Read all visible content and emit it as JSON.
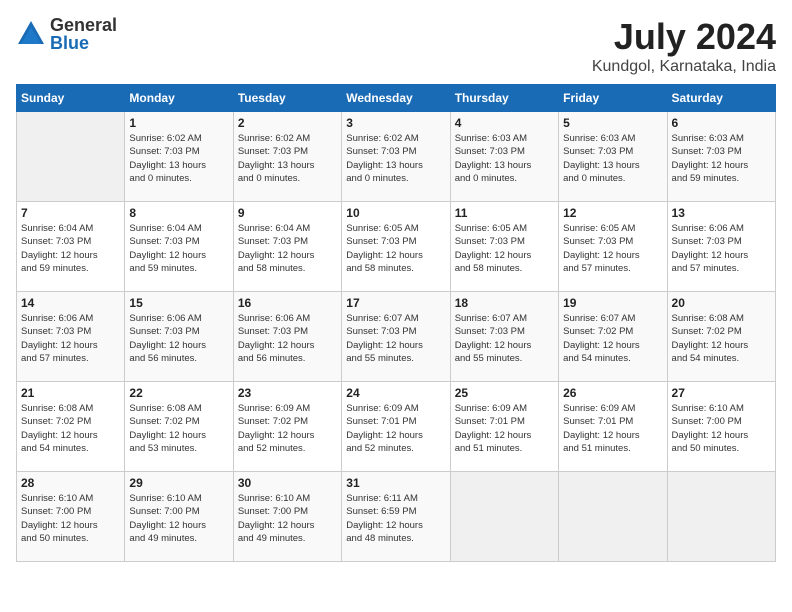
{
  "header": {
    "logo_general": "General",
    "logo_blue": "Blue",
    "title": "July 2024",
    "location": "Kundgol, Karnataka, India"
  },
  "calendar": {
    "days_of_week": [
      "Sunday",
      "Monday",
      "Tuesday",
      "Wednesday",
      "Thursday",
      "Friday",
      "Saturday"
    ],
    "weeks": [
      [
        {
          "day": "",
          "info": ""
        },
        {
          "day": "1",
          "info": "Sunrise: 6:02 AM\nSunset: 7:03 PM\nDaylight: 13 hours\nand 0 minutes."
        },
        {
          "day": "2",
          "info": "Sunrise: 6:02 AM\nSunset: 7:03 PM\nDaylight: 13 hours\nand 0 minutes."
        },
        {
          "day": "3",
          "info": "Sunrise: 6:02 AM\nSunset: 7:03 PM\nDaylight: 13 hours\nand 0 minutes."
        },
        {
          "day": "4",
          "info": "Sunrise: 6:03 AM\nSunset: 7:03 PM\nDaylight: 13 hours\nand 0 minutes."
        },
        {
          "day": "5",
          "info": "Sunrise: 6:03 AM\nSunset: 7:03 PM\nDaylight: 13 hours\nand 0 minutes."
        },
        {
          "day": "6",
          "info": "Sunrise: 6:03 AM\nSunset: 7:03 PM\nDaylight: 12 hours\nand 59 minutes."
        }
      ],
      [
        {
          "day": "7",
          "info": "Sunrise: 6:04 AM\nSunset: 7:03 PM\nDaylight: 12 hours\nand 59 minutes."
        },
        {
          "day": "8",
          "info": "Sunrise: 6:04 AM\nSunset: 7:03 PM\nDaylight: 12 hours\nand 59 minutes."
        },
        {
          "day": "9",
          "info": "Sunrise: 6:04 AM\nSunset: 7:03 PM\nDaylight: 12 hours\nand 58 minutes."
        },
        {
          "day": "10",
          "info": "Sunrise: 6:05 AM\nSunset: 7:03 PM\nDaylight: 12 hours\nand 58 minutes."
        },
        {
          "day": "11",
          "info": "Sunrise: 6:05 AM\nSunset: 7:03 PM\nDaylight: 12 hours\nand 58 minutes."
        },
        {
          "day": "12",
          "info": "Sunrise: 6:05 AM\nSunset: 7:03 PM\nDaylight: 12 hours\nand 57 minutes."
        },
        {
          "day": "13",
          "info": "Sunrise: 6:06 AM\nSunset: 7:03 PM\nDaylight: 12 hours\nand 57 minutes."
        }
      ],
      [
        {
          "day": "14",
          "info": "Sunrise: 6:06 AM\nSunset: 7:03 PM\nDaylight: 12 hours\nand 57 minutes."
        },
        {
          "day": "15",
          "info": "Sunrise: 6:06 AM\nSunset: 7:03 PM\nDaylight: 12 hours\nand 56 minutes."
        },
        {
          "day": "16",
          "info": "Sunrise: 6:06 AM\nSunset: 7:03 PM\nDaylight: 12 hours\nand 56 minutes."
        },
        {
          "day": "17",
          "info": "Sunrise: 6:07 AM\nSunset: 7:03 PM\nDaylight: 12 hours\nand 55 minutes."
        },
        {
          "day": "18",
          "info": "Sunrise: 6:07 AM\nSunset: 7:03 PM\nDaylight: 12 hours\nand 55 minutes."
        },
        {
          "day": "19",
          "info": "Sunrise: 6:07 AM\nSunset: 7:02 PM\nDaylight: 12 hours\nand 54 minutes."
        },
        {
          "day": "20",
          "info": "Sunrise: 6:08 AM\nSunset: 7:02 PM\nDaylight: 12 hours\nand 54 minutes."
        }
      ],
      [
        {
          "day": "21",
          "info": "Sunrise: 6:08 AM\nSunset: 7:02 PM\nDaylight: 12 hours\nand 54 minutes."
        },
        {
          "day": "22",
          "info": "Sunrise: 6:08 AM\nSunset: 7:02 PM\nDaylight: 12 hours\nand 53 minutes."
        },
        {
          "day": "23",
          "info": "Sunrise: 6:09 AM\nSunset: 7:02 PM\nDaylight: 12 hours\nand 52 minutes."
        },
        {
          "day": "24",
          "info": "Sunrise: 6:09 AM\nSunset: 7:01 PM\nDaylight: 12 hours\nand 52 minutes."
        },
        {
          "day": "25",
          "info": "Sunrise: 6:09 AM\nSunset: 7:01 PM\nDaylight: 12 hours\nand 51 minutes."
        },
        {
          "day": "26",
          "info": "Sunrise: 6:09 AM\nSunset: 7:01 PM\nDaylight: 12 hours\nand 51 minutes."
        },
        {
          "day": "27",
          "info": "Sunrise: 6:10 AM\nSunset: 7:00 PM\nDaylight: 12 hours\nand 50 minutes."
        }
      ],
      [
        {
          "day": "28",
          "info": "Sunrise: 6:10 AM\nSunset: 7:00 PM\nDaylight: 12 hours\nand 50 minutes."
        },
        {
          "day": "29",
          "info": "Sunrise: 6:10 AM\nSunset: 7:00 PM\nDaylight: 12 hours\nand 49 minutes."
        },
        {
          "day": "30",
          "info": "Sunrise: 6:10 AM\nSunset: 7:00 PM\nDaylight: 12 hours\nand 49 minutes."
        },
        {
          "day": "31",
          "info": "Sunrise: 6:11 AM\nSunset: 6:59 PM\nDaylight: 12 hours\nand 48 minutes."
        },
        {
          "day": "",
          "info": ""
        },
        {
          "day": "",
          "info": ""
        },
        {
          "day": "",
          "info": ""
        }
      ]
    ]
  }
}
